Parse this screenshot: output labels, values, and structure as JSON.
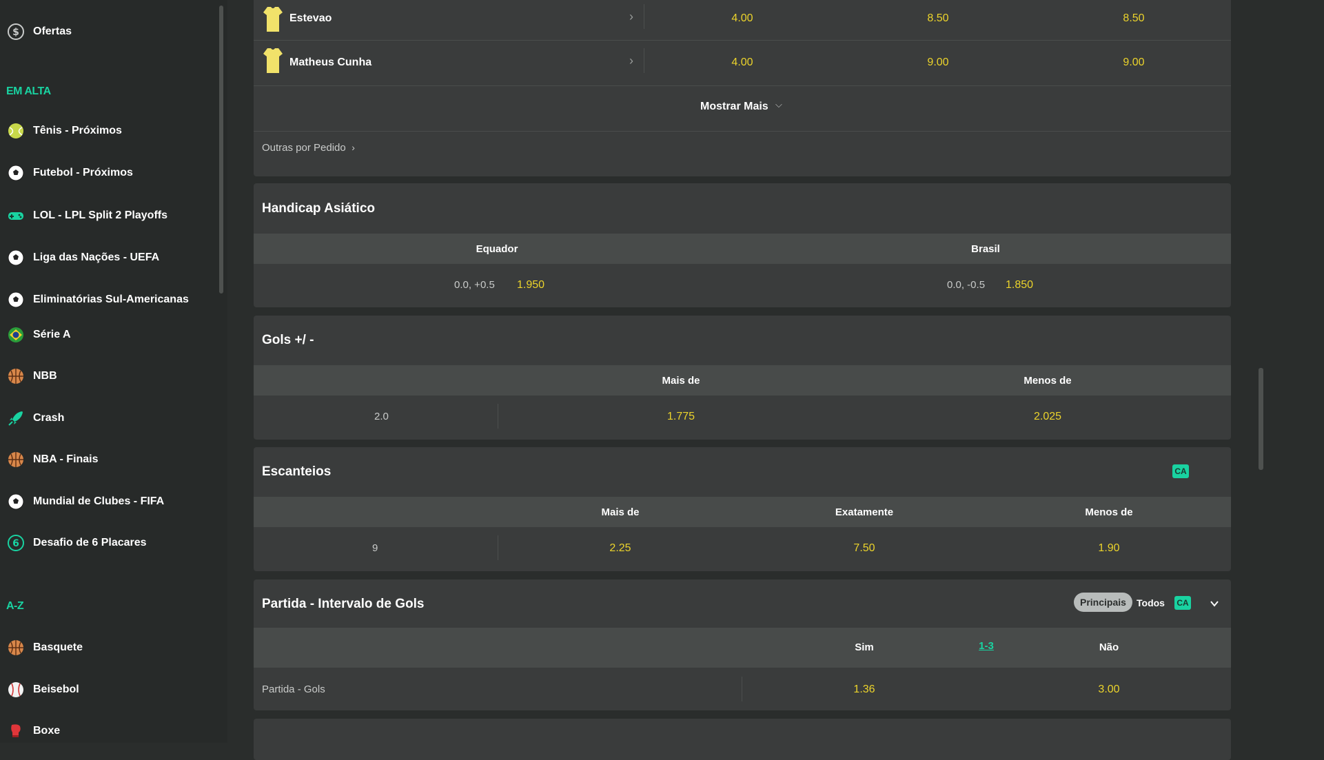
{
  "sidebar": {
    "top_item": {
      "label": "Ofertas",
      "icon": "dollar-coin-icon"
    },
    "trending_heading": "EM ALTA",
    "trending": [
      {
        "label": "Tênis - Próximos",
        "icon": "tennis-ball-icon"
      },
      {
        "label": "Futebol - Próximos",
        "icon": "soccer-ball-icon"
      },
      {
        "label": "LOL - LPL Split 2 Playoffs",
        "icon": "gamepad-icon"
      },
      {
        "label": "Liga das Nações - UEFA",
        "icon": "soccer-ball-icon"
      },
      {
        "label": "Eliminatórias Sul-Americanas",
        "icon": "soccer-ball-icon"
      },
      {
        "label": "Série A",
        "icon": "brazil-flag-icon"
      },
      {
        "label": "NBB",
        "icon": "basketball-icon"
      },
      {
        "label": "Crash",
        "icon": "rocket-icon"
      },
      {
        "label": "NBA - Finais",
        "icon": "basketball-icon"
      },
      {
        "label": "Mundial de Clubes - FIFA",
        "icon": "soccer-ball-icon"
      },
      {
        "label": "Desafio de 6 Placares",
        "icon": "six-badge-icon"
      }
    ],
    "az_heading": "A-Z",
    "az": [
      {
        "label": "Basquete",
        "icon": "basketball-icon"
      },
      {
        "label": "Beisebol",
        "icon": "baseball-icon"
      },
      {
        "label": "Boxe",
        "icon": "boxing-glove-icon"
      }
    ]
  },
  "players": {
    "rows": [
      {
        "name": "Estevao",
        "odds": [
          "4.00",
          "8.50",
          "8.50"
        ]
      },
      {
        "name": "Matheus Cunha",
        "odds": [
          "4.00",
          "9.00",
          "9.00"
        ]
      }
    ],
    "show_more": "Mostrar Mais",
    "others": "Outras por Pedido"
  },
  "handicap": {
    "title": "Handicap Asiático",
    "col1": "Equador",
    "col2": "Brasil",
    "line1": "0.0, +0.5",
    "odd1": "1.950",
    "line2": "0.0, -0.5",
    "odd2": "1.850"
  },
  "goals": {
    "title": "Gols +/ -",
    "col_over": "Mais de",
    "col_under": "Menos de",
    "line": "2.0",
    "over": "1.775",
    "under": "2.025"
  },
  "corners": {
    "title": "Escanteios",
    "badge": "CA",
    "col_over": "Mais de",
    "col_exact": "Exatamente",
    "col_under": "Menos de",
    "line": "9",
    "over": "2.25",
    "exact": "7.50",
    "under": "1.90"
  },
  "interval": {
    "title": "Partida - Intervalo de Gols",
    "tab_main": "Principais",
    "tab_all": "Todos",
    "badge": "CA",
    "col_yes": "Sim",
    "range": "1-3",
    "col_no": "Não",
    "row_label": "Partida - Gols",
    "yes": "1.36",
    "no": "3.00"
  },
  "colors": {
    "accent": "#19d3a1",
    "odds": "#ecd42b",
    "card": "#3a3c3c",
    "background": "#2a2d2c"
  }
}
